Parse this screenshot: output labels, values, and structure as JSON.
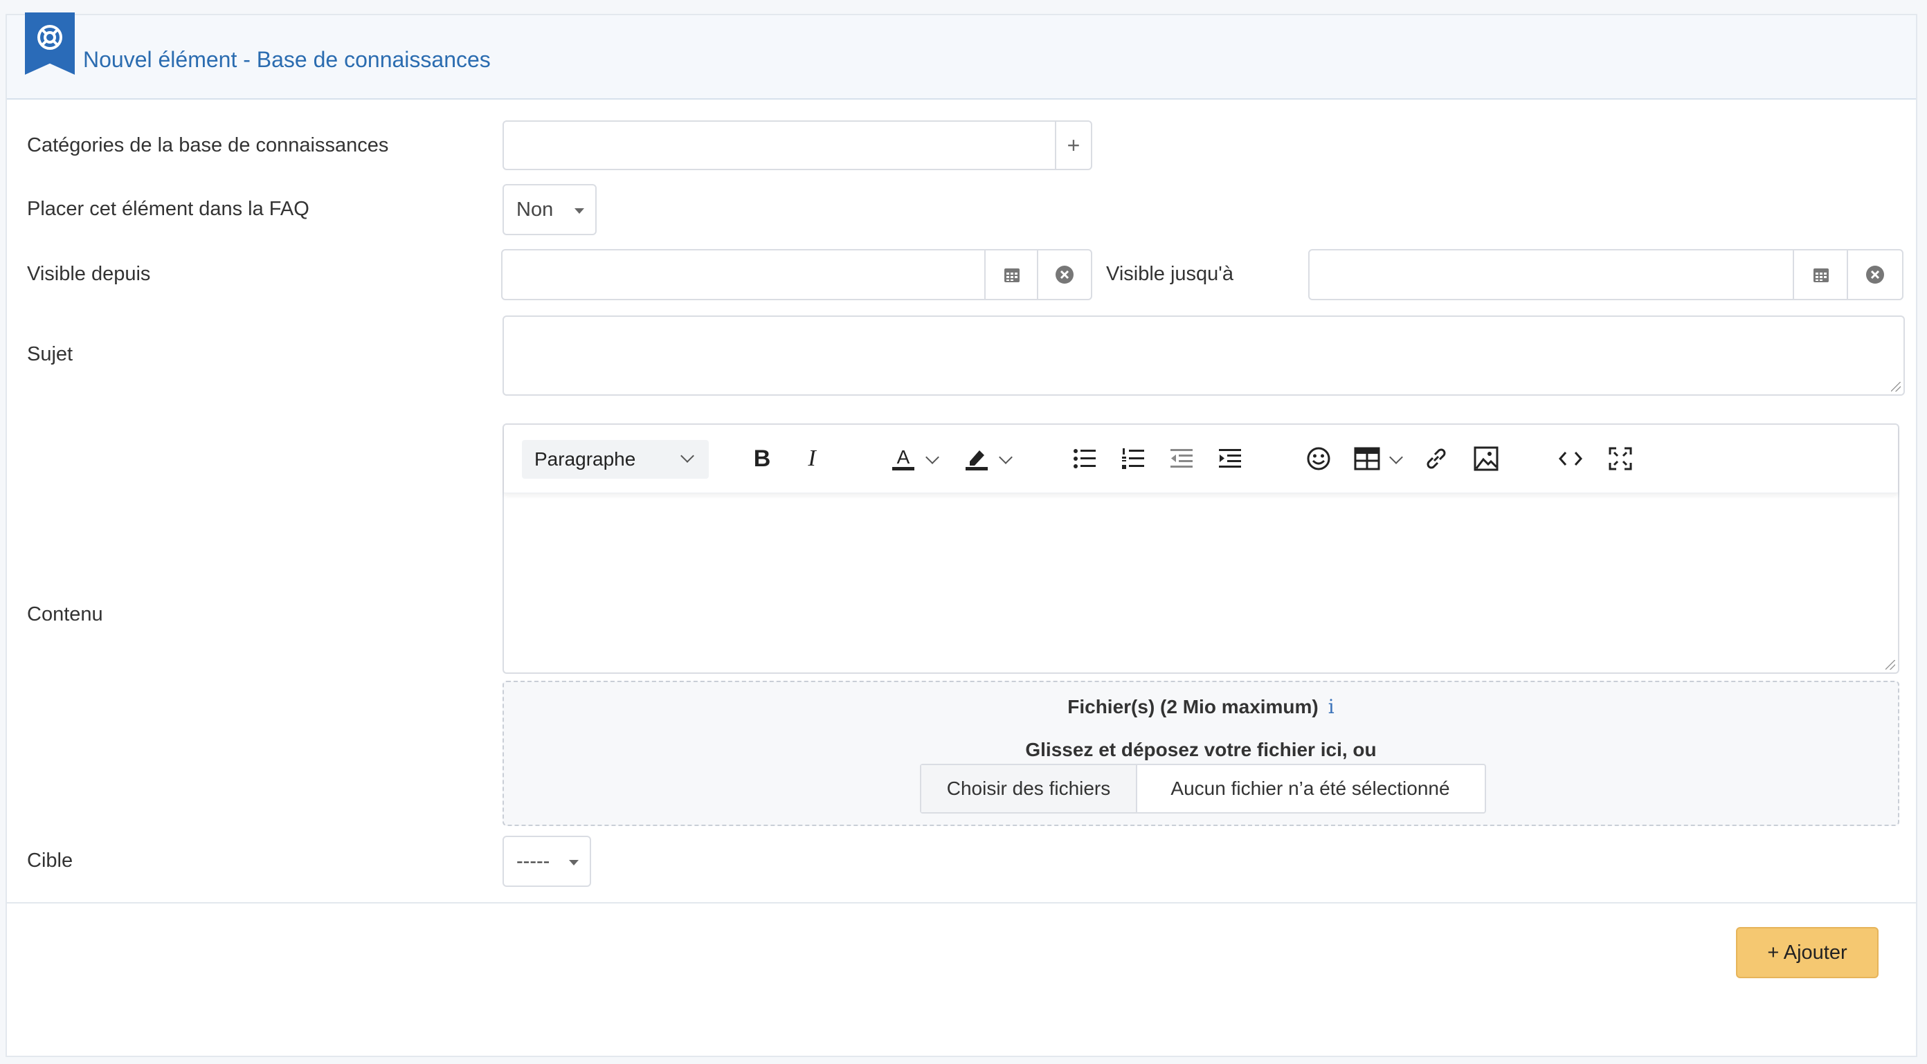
{
  "header": {
    "title": "Nouvel élément - Base de connaissances",
    "icon": "lifebuoy-icon"
  },
  "fields": {
    "categories": {
      "label": "Catégories de la base de connaissances",
      "value": "",
      "add_glyph": "+"
    },
    "faq": {
      "label": "Placer cet élément dans la FAQ",
      "value": "Non"
    },
    "visible_from": {
      "label": "Visible depuis",
      "value": ""
    },
    "visible_until": {
      "label": "Visible jusqu'à",
      "value": ""
    },
    "subject": {
      "label": "Sujet",
      "value": ""
    },
    "content": {
      "label": "Contenu",
      "value": ""
    },
    "target": {
      "label": "Cible",
      "value": "-----"
    }
  },
  "editor": {
    "block_format": "Paragraphe",
    "toolbar": [
      "bold",
      "italic",
      "text-color",
      "highlight-color",
      "bullet-list",
      "numbered-list",
      "outdent",
      "indent",
      "emoji",
      "table",
      "link",
      "image",
      "source-code",
      "fullscreen"
    ],
    "bold_glyph": "B",
    "italic_glyph": "I",
    "text_color_glyph": "A"
  },
  "upload": {
    "title": "Fichier(s) (2 Mio maximum)",
    "info_glyph": "i",
    "drop_text": "Glissez et déposez votre fichier ici, ou",
    "choose_button": "Choisir des fichiers",
    "no_file": "Aucun fichier n’a été sélectionné"
  },
  "actions": {
    "add_label": "+ Ajouter"
  },
  "colors": {
    "accent": "#2a6bb8",
    "add_button": "#f5c871"
  }
}
